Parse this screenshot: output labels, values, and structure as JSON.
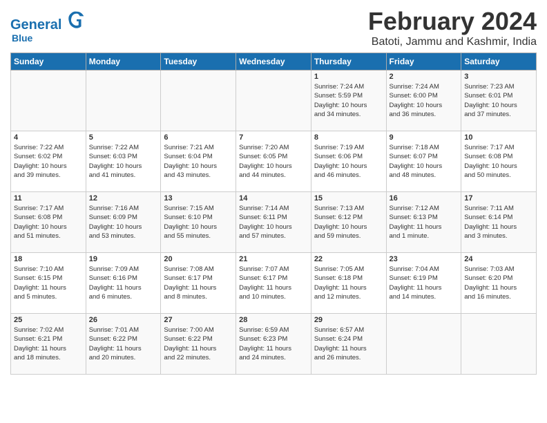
{
  "header": {
    "logo_line1": "General",
    "logo_line2": "Blue",
    "month": "February 2024",
    "location": "Batoti, Jammu and Kashmir, India"
  },
  "days_of_week": [
    "Sunday",
    "Monday",
    "Tuesday",
    "Wednesday",
    "Thursday",
    "Friday",
    "Saturday"
  ],
  "weeks": [
    [
      {
        "day": "",
        "info": ""
      },
      {
        "day": "",
        "info": ""
      },
      {
        "day": "",
        "info": ""
      },
      {
        "day": "",
        "info": ""
      },
      {
        "day": "1",
        "info": "Sunrise: 7:24 AM\nSunset: 5:59 PM\nDaylight: 10 hours\nand 34 minutes."
      },
      {
        "day": "2",
        "info": "Sunrise: 7:24 AM\nSunset: 6:00 PM\nDaylight: 10 hours\nand 36 minutes."
      },
      {
        "day": "3",
        "info": "Sunrise: 7:23 AM\nSunset: 6:01 PM\nDaylight: 10 hours\nand 37 minutes."
      }
    ],
    [
      {
        "day": "4",
        "info": "Sunrise: 7:22 AM\nSunset: 6:02 PM\nDaylight: 10 hours\nand 39 minutes."
      },
      {
        "day": "5",
        "info": "Sunrise: 7:22 AM\nSunset: 6:03 PM\nDaylight: 10 hours\nand 41 minutes."
      },
      {
        "day": "6",
        "info": "Sunrise: 7:21 AM\nSunset: 6:04 PM\nDaylight: 10 hours\nand 43 minutes."
      },
      {
        "day": "7",
        "info": "Sunrise: 7:20 AM\nSunset: 6:05 PM\nDaylight: 10 hours\nand 44 minutes."
      },
      {
        "day": "8",
        "info": "Sunrise: 7:19 AM\nSunset: 6:06 PM\nDaylight: 10 hours\nand 46 minutes."
      },
      {
        "day": "9",
        "info": "Sunrise: 7:18 AM\nSunset: 6:07 PM\nDaylight: 10 hours\nand 48 minutes."
      },
      {
        "day": "10",
        "info": "Sunrise: 7:17 AM\nSunset: 6:08 PM\nDaylight: 10 hours\nand 50 minutes."
      }
    ],
    [
      {
        "day": "11",
        "info": "Sunrise: 7:17 AM\nSunset: 6:08 PM\nDaylight: 10 hours\nand 51 minutes."
      },
      {
        "day": "12",
        "info": "Sunrise: 7:16 AM\nSunset: 6:09 PM\nDaylight: 10 hours\nand 53 minutes."
      },
      {
        "day": "13",
        "info": "Sunrise: 7:15 AM\nSunset: 6:10 PM\nDaylight: 10 hours\nand 55 minutes."
      },
      {
        "day": "14",
        "info": "Sunrise: 7:14 AM\nSunset: 6:11 PM\nDaylight: 10 hours\nand 57 minutes."
      },
      {
        "day": "15",
        "info": "Sunrise: 7:13 AM\nSunset: 6:12 PM\nDaylight: 10 hours\nand 59 minutes."
      },
      {
        "day": "16",
        "info": "Sunrise: 7:12 AM\nSunset: 6:13 PM\nDaylight: 11 hours\nand 1 minute."
      },
      {
        "day": "17",
        "info": "Sunrise: 7:11 AM\nSunset: 6:14 PM\nDaylight: 11 hours\nand 3 minutes."
      }
    ],
    [
      {
        "day": "18",
        "info": "Sunrise: 7:10 AM\nSunset: 6:15 PM\nDaylight: 11 hours\nand 5 minutes."
      },
      {
        "day": "19",
        "info": "Sunrise: 7:09 AM\nSunset: 6:16 PM\nDaylight: 11 hours\nand 6 minutes."
      },
      {
        "day": "20",
        "info": "Sunrise: 7:08 AM\nSunset: 6:17 PM\nDaylight: 11 hours\nand 8 minutes."
      },
      {
        "day": "21",
        "info": "Sunrise: 7:07 AM\nSunset: 6:17 PM\nDaylight: 11 hours\nand 10 minutes."
      },
      {
        "day": "22",
        "info": "Sunrise: 7:05 AM\nSunset: 6:18 PM\nDaylight: 11 hours\nand 12 minutes."
      },
      {
        "day": "23",
        "info": "Sunrise: 7:04 AM\nSunset: 6:19 PM\nDaylight: 11 hours\nand 14 minutes."
      },
      {
        "day": "24",
        "info": "Sunrise: 7:03 AM\nSunset: 6:20 PM\nDaylight: 11 hours\nand 16 minutes."
      }
    ],
    [
      {
        "day": "25",
        "info": "Sunrise: 7:02 AM\nSunset: 6:21 PM\nDaylight: 11 hours\nand 18 minutes."
      },
      {
        "day": "26",
        "info": "Sunrise: 7:01 AM\nSunset: 6:22 PM\nDaylight: 11 hours\nand 20 minutes."
      },
      {
        "day": "27",
        "info": "Sunrise: 7:00 AM\nSunset: 6:22 PM\nDaylight: 11 hours\nand 22 minutes."
      },
      {
        "day": "28",
        "info": "Sunrise: 6:59 AM\nSunset: 6:23 PM\nDaylight: 11 hours\nand 24 minutes."
      },
      {
        "day": "29",
        "info": "Sunrise: 6:57 AM\nSunset: 6:24 PM\nDaylight: 11 hours\nand 26 minutes."
      },
      {
        "day": "",
        "info": ""
      },
      {
        "day": "",
        "info": ""
      }
    ]
  ]
}
